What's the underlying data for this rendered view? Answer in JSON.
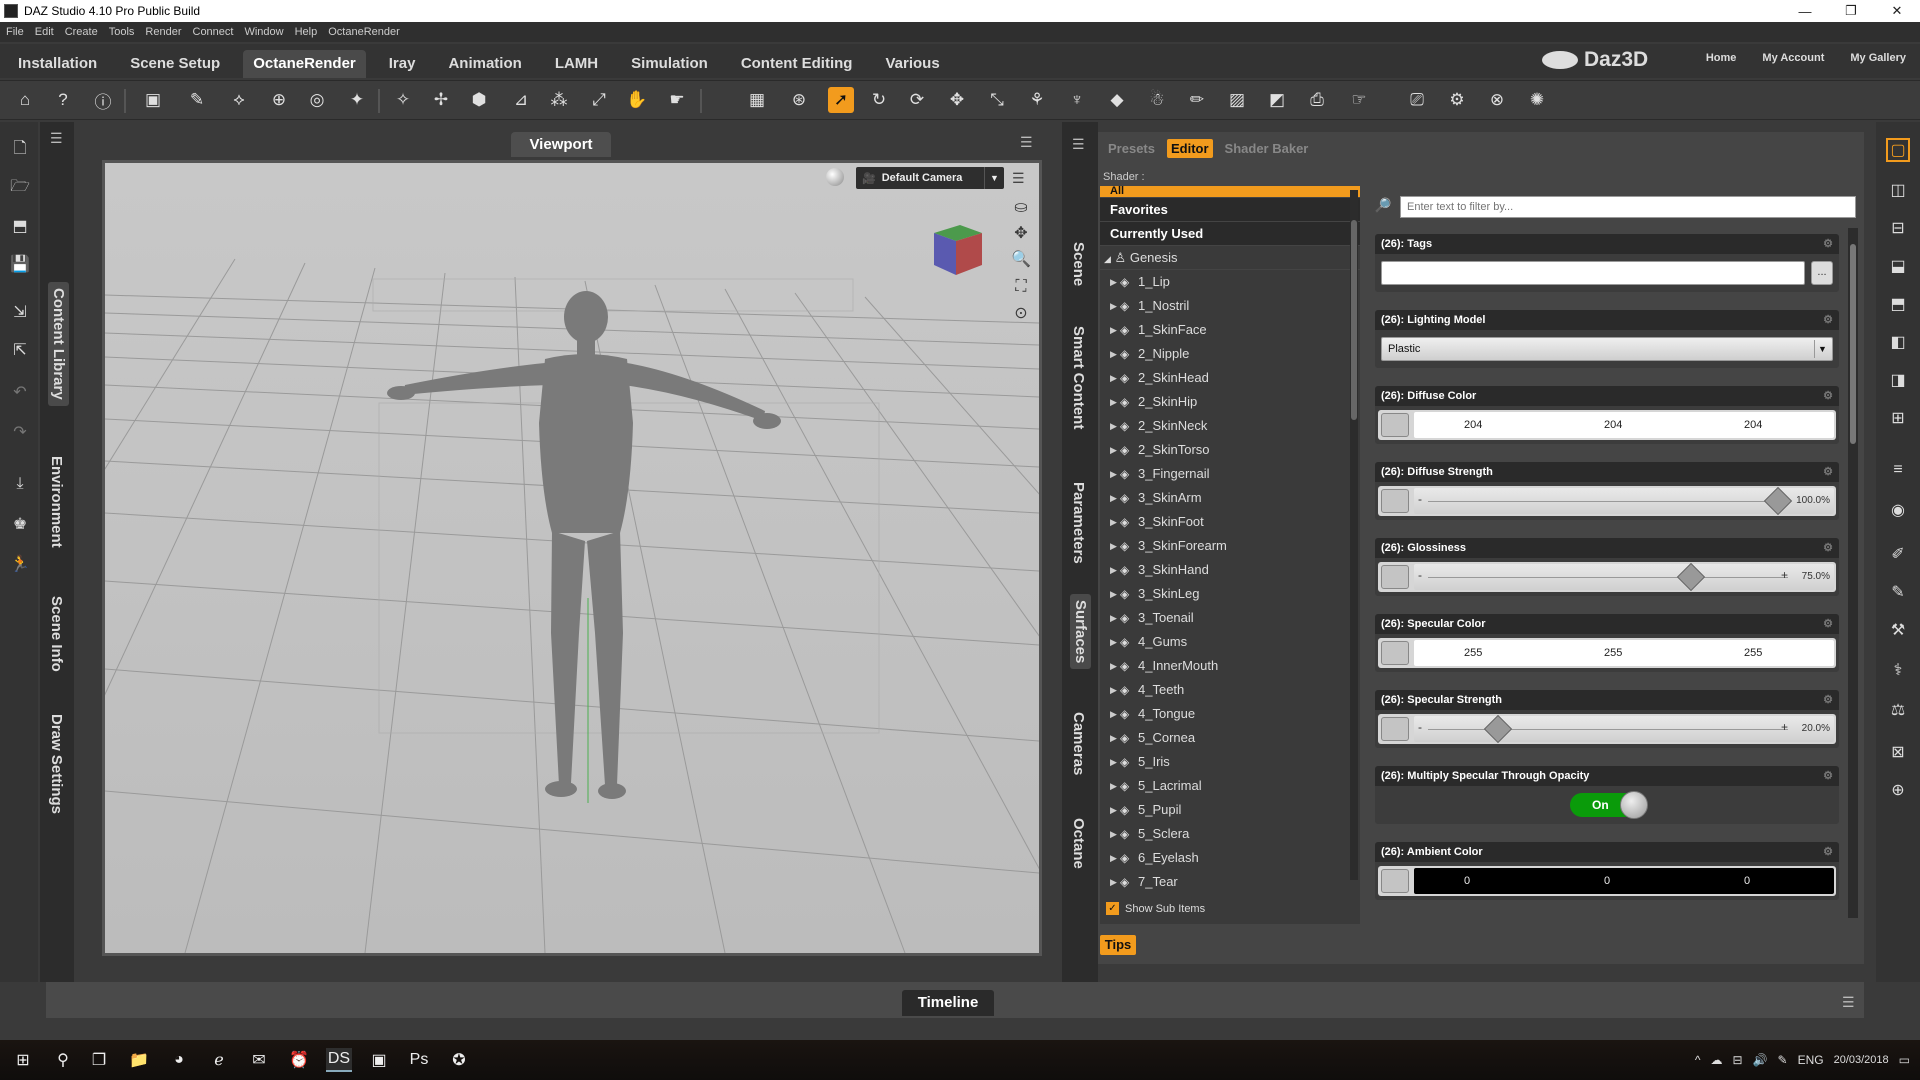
{
  "window": {
    "title": "DAZ Studio 4.10 Pro Public Build",
    "minimize": "—",
    "maximize": "❐",
    "close": "✕"
  },
  "menu": [
    "File",
    "Edit",
    "Create",
    "Tools",
    "Render",
    "Connect",
    "Window",
    "Help",
    "OctaneRender"
  ],
  "room_tabs": [
    "Installation",
    "Scene Setup",
    "OctaneRender",
    "Iray",
    "Animation",
    "LAMH",
    "Simulation",
    "Content Editing",
    "Various"
  ],
  "active_room_tab": "OctaneRender",
  "brand": "Daz3D",
  "top_links": [
    "Home",
    "My Account",
    "My Gallery"
  ],
  "left_tabs": [
    "Content Library",
    "Environment",
    "Scene Info",
    "Draw Settings"
  ],
  "viewport": {
    "title": "Viewport",
    "camera": "Default Camera"
  },
  "mid_tabs": [
    "Scene",
    "Smart Content",
    "Parameters",
    "Surfaces",
    "Cameras",
    "Octane"
  ],
  "surfaces": {
    "tabs": [
      "Presets",
      "Editor",
      "Shader Baker"
    ],
    "active_tab": "Editor",
    "shader_label": "Shader :",
    "tree_headers": [
      "All",
      "Favorites",
      "Currently Used"
    ],
    "root": "Genesis",
    "items": [
      "1_Lip",
      "1_Nostril",
      "1_SkinFace",
      "2_Nipple",
      "2_SkinHead",
      "2_SkinHip",
      "2_SkinNeck",
      "2_SkinTorso",
      "3_Fingernail",
      "3_SkinArm",
      "3_SkinFoot",
      "3_SkinForearm",
      "3_SkinHand",
      "3_SkinLeg",
      "3_Toenail",
      "4_Gums",
      "4_InnerMouth",
      "4_Teeth",
      "4_Tongue",
      "5_Cornea",
      "5_Iris",
      "5_Lacrimal",
      "5_Pupil",
      "5_Sclera",
      "6_Eyelash",
      "7_Tear"
    ],
    "show_sub_items": "Show Sub Items",
    "filter_placeholder": "Enter text to filter by...",
    "tips": "Tips",
    "props": {
      "tags": {
        "label": "(26): Tags",
        "dots": "..."
      },
      "lighting_model": {
        "label": "(26): Lighting Model",
        "value": "Plastic"
      },
      "diffuse_color": {
        "label": "(26): Diffuse Color",
        "r": "204",
        "g": "204",
        "b": "204"
      },
      "diffuse_strength": {
        "label": "(26): Diffuse Strength",
        "value": "100.0%",
        "fraction": 1.0
      },
      "glossiness": {
        "label": "(26): Glossiness",
        "value": "75.0%",
        "fraction": 0.75
      },
      "specular_color": {
        "label": "(26): Specular Color",
        "r": "255",
        "g": "255",
        "b": "255"
      },
      "specular_strength": {
        "label": "(26): Specular Strength",
        "value": "20.0%",
        "fraction": 0.2
      },
      "multiply_specular": {
        "label": "(26): Multiply Specular Through Opacity",
        "value": "On"
      },
      "ambient_color": {
        "label": "(26): Ambient Color",
        "r": "0",
        "g": "0",
        "b": "0"
      }
    }
  },
  "timeline": {
    "label": "Timeline"
  },
  "taskbar": {
    "lang": "ENG",
    "date": "20/03/2018"
  },
  "colors": {
    "accent": "#f29b1d",
    "toggle_on": "#0a9b0a"
  }
}
